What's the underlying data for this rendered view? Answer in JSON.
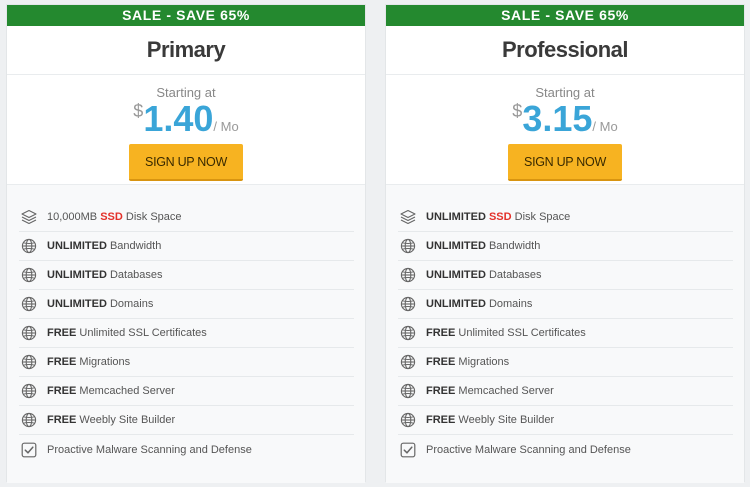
{
  "plans": [
    {
      "banner": "SALE - SAVE 65%",
      "name": "Primary",
      "starting_at": "Starting at",
      "currency": "$",
      "amount": "1.40",
      "per": "/ Mo",
      "cta": "SIGN UP NOW",
      "features": [
        {
          "icon": "layers-icon",
          "bold": "",
          "pre": "10,000MB ",
          "hl": "SSD",
          "rest": " Disk Space"
        },
        {
          "icon": "globe-icon",
          "bold": "UNLIMITED",
          "pre": "",
          "hl": "",
          "rest": " Bandwidth"
        },
        {
          "icon": "globe-icon",
          "bold": "UNLIMITED",
          "pre": "",
          "hl": "",
          "rest": " Databases"
        },
        {
          "icon": "globe-icon",
          "bold": "UNLIMITED",
          "pre": "",
          "hl": "",
          "rest": " Domains"
        },
        {
          "icon": "globe-icon",
          "bold": "FREE",
          "pre": "",
          "hl": "",
          "rest": " Unlimited SSL Certificates"
        },
        {
          "icon": "globe-icon",
          "bold": "FREE",
          "pre": "",
          "hl": "",
          "rest": " Migrations"
        },
        {
          "icon": "globe-icon",
          "bold": "FREE",
          "pre": "",
          "hl": "",
          "rest": " Memcached Server"
        },
        {
          "icon": "globe-icon",
          "bold": "FREE",
          "pre": "",
          "hl": "",
          "rest": " Weebly Site Builder"
        },
        {
          "icon": "checkbox-icon",
          "bold": "",
          "pre": "",
          "hl": "",
          "rest": "Proactive Malware Scanning and Defense"
        }
      ]
    },
    {
      "banner": "SALE - SAVE 65%",
      "name": "Professional",
      "starting_at": "Starting at",
      "currency": "$",
      "amount": "3.15",
      "per": "/ Mo",
      "cta": "SIGN UP NOW",
      "features": [
        {
          "icon": "layers-icon",
          "bold": "UNLIMITED",
          "pre": " ",
          "hl": "SSD",
          "rest": " Disk Space"
        },
        {
          "icon": "globe-icon",
          "bold": "UNLIMITED",
          "pre": "",
          "hl": "",
          "rest": " Bandwidth"
        },
        {
          "icon": "globe-icon",
          "bold": "UNLIMITED",
          "pre": "",
          "hl": "",
          "rest": " Databases"
        },
        {
          "icon": "globe-icon",
          "bold": "UNLIMITED",
          "pre": "",
          "hl": "",
          "rest": " Domains"
        },
        {
          "icon": "globe-icon",
          "bold": "FREE",
          "pre": "",
          "hl": "",
          "rest": " Unlimited SSL Certificates"
        },
        {
          "icon": "globe-icon",
          "bold": "FREE",
          "pre": "",
          "hl": "",
          "rest": " Migrations"
        },
        {
          "icon": "globe-icon",
          "bold": "FREE",
          "pre": "",
          "hl": "",
          "rest": " Memcached Server"
        },
        {
          "icon": "globe-icon",
          "bold": "FREE",
          "pre": "",
          "hl": "",
          "rest": " Weebly Site Builder"
        },
        {
          "icon": "checkbox-icon",
          "bold": "",
          "pre": "",
          "hl": "",
          "rest": "Proactive Malware Scanning and Defense"
        }
      ]
    }
  ]
}
